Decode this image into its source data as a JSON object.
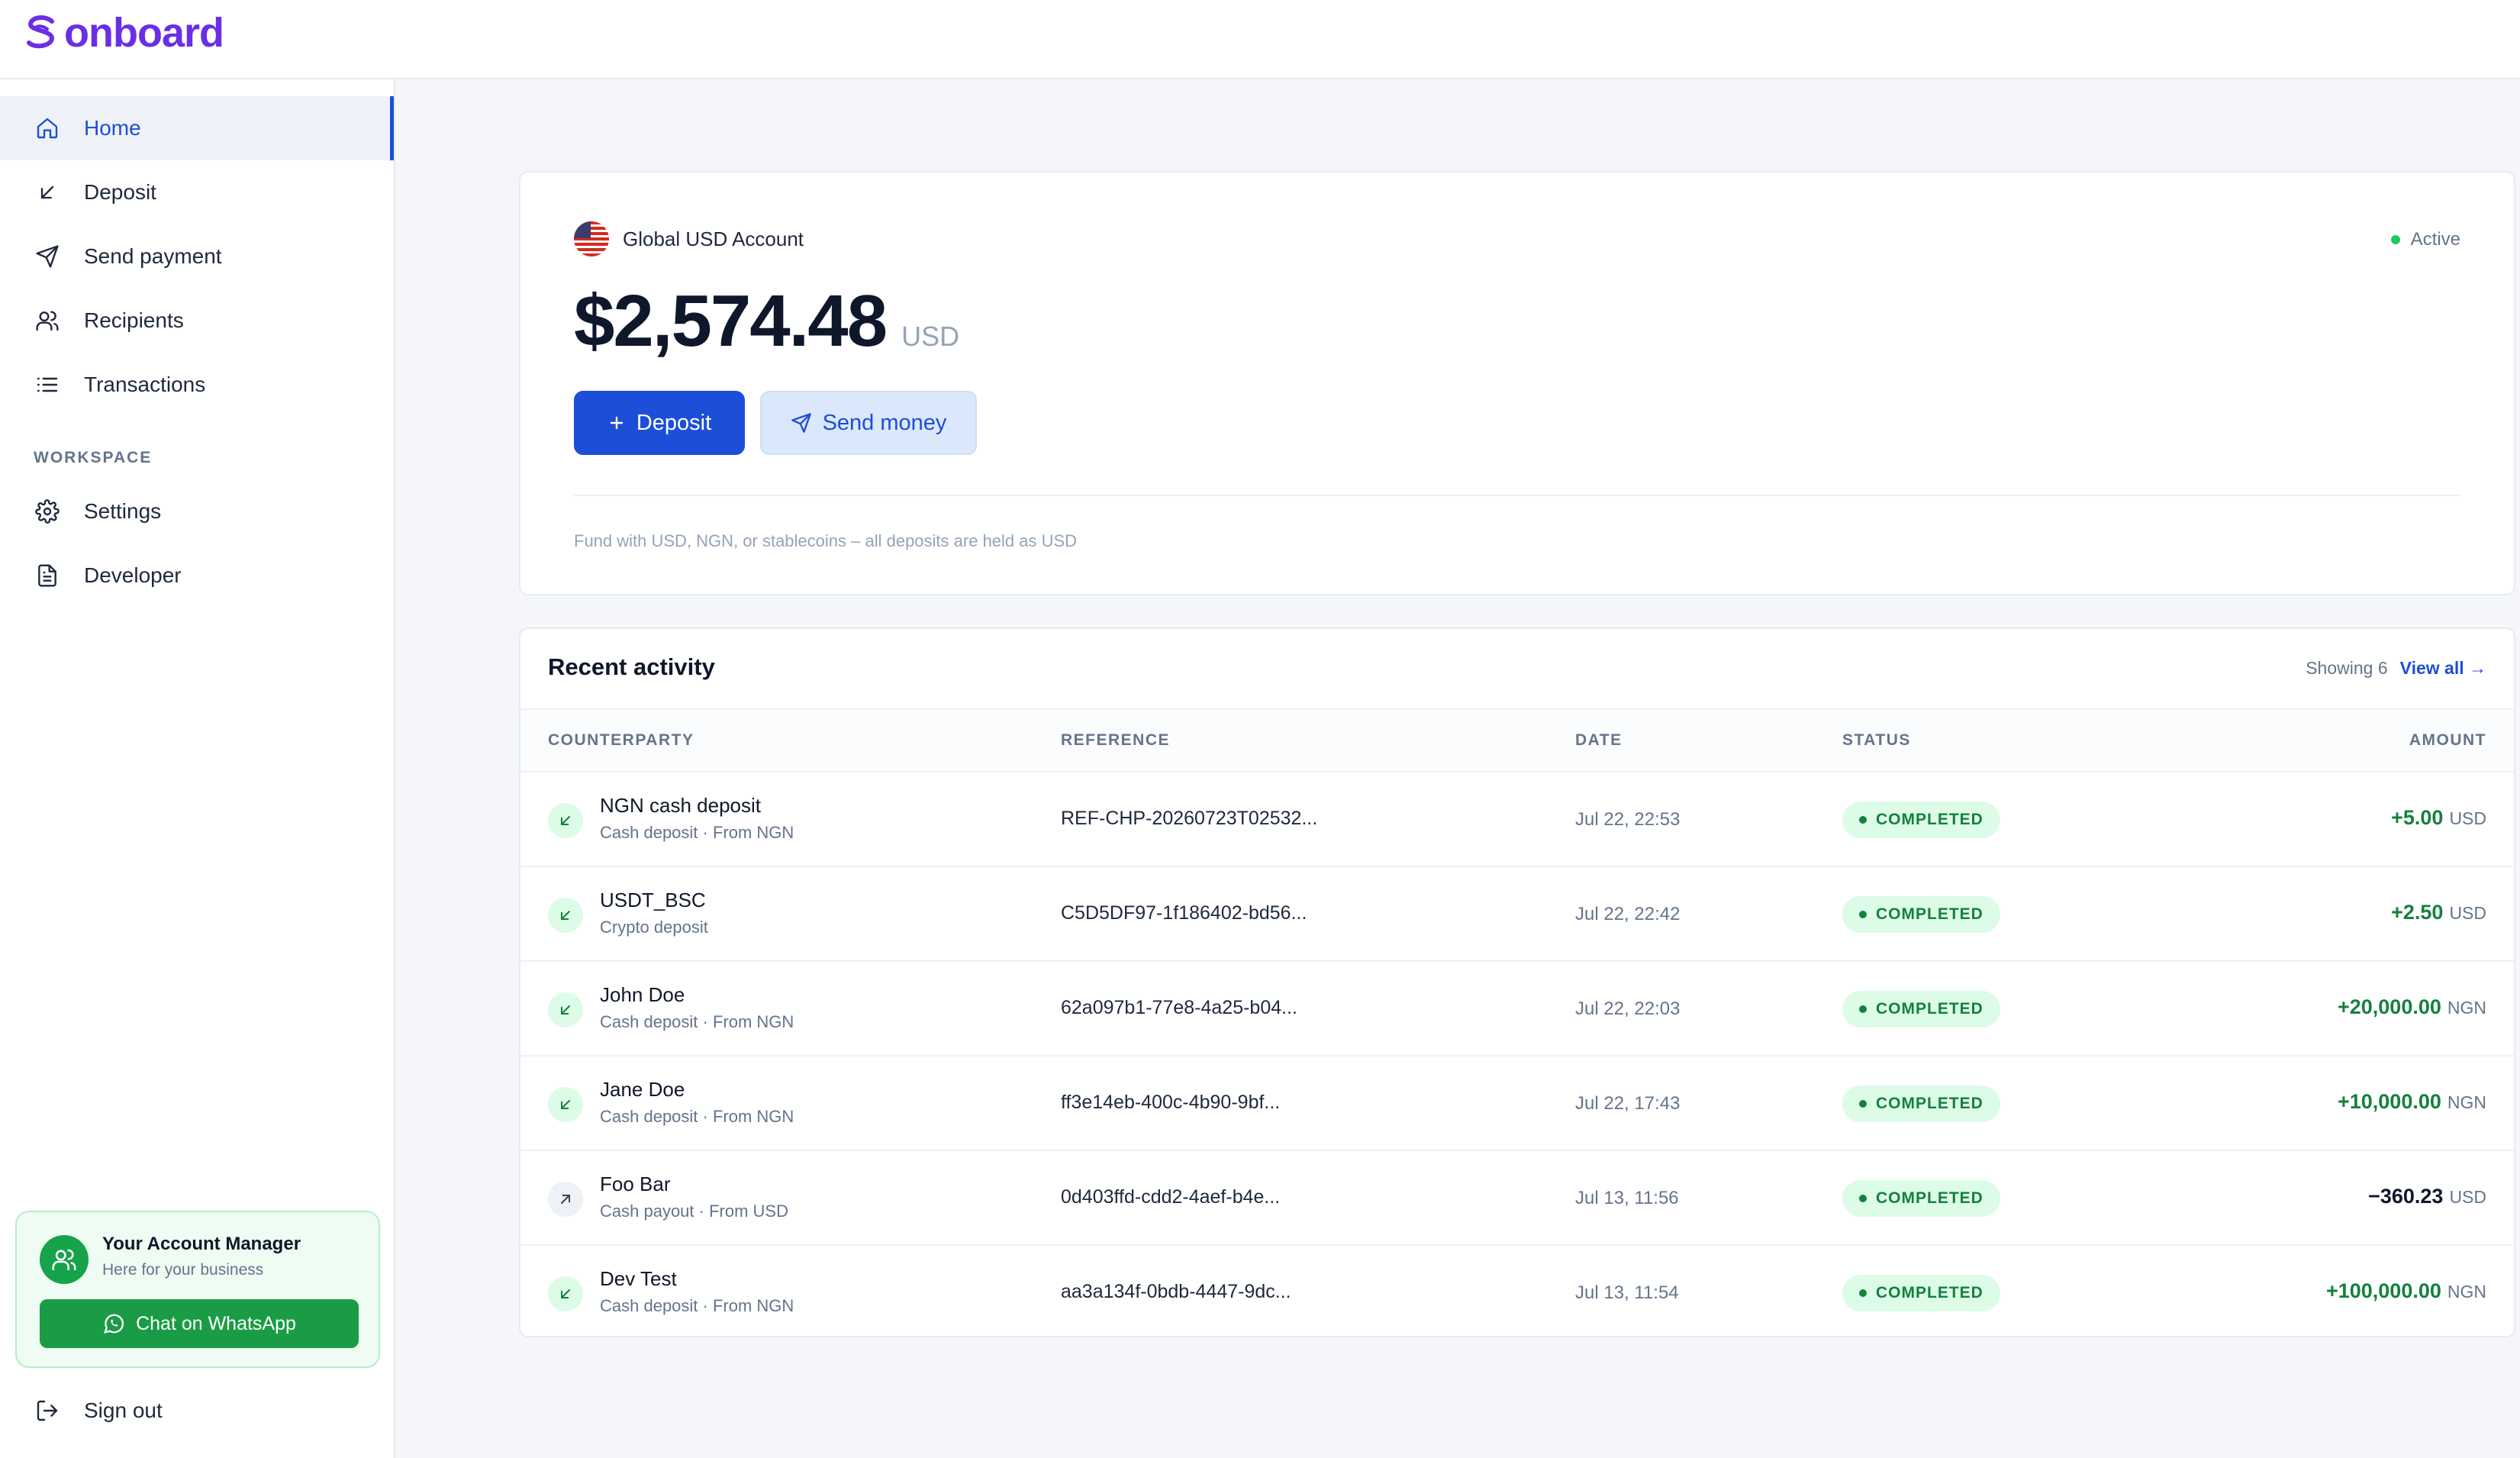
{
  "app": {
    "name": "onboard",
    "brand_color": "#6a2ee8",
    "accent_color": "#1d4ed8",
    "success_color": "#15803d"
  },
  "sidebar": {
    "items": [
      {
        "label": "Home",
        "icon": "home-icon",
        "active": true
      },
      {
        "label": "Deposit",
        "icon": "arrow-down-left-icon"
      },
      {
        "label": "Send payment",
        "icon": "send-icon"
      },
      {
        "label": "Recipients",
        "icon": "users-icon"
      },
      {
        "label": "Transactions",
        "icon": "list-icon"
      }
    ],
    "workspace_label": "WORKSPACE",
    "workspace_items": [
      {
        "label": "Settings",
        "icon": "gear-icon"
      },
      {
        "label": "Developer",
        "icon": "document-icon"
      }
    ],
    "manager": {
      "title": "Your Account Manager",
      "subtitle": "Here for your business",
      "button_label": "Chat on WhatsApp"
    },
    "sign_out_label": "Sign out"
  },
  "account": {
    "name": "Global USD Account",
    "status": "Active",
    "balance": "$2,574.48",
    "currency": "USD",
    "deposit_label": "Deposit",
    "send_label": "Send money",
    "note": "Fund with USD, NGN, or stablecoins – all deposits are held as USD"
  },
  "activity": {
    "title": "Recent activity",
    "showing": "Showing 6",
    "view_all": "View all →",
    "columns": {
      "counterparty": "COUNTERPARTY",
      "reference": "REFERENCE",
      "date": "DATE",
      "status": "STATUS",
      "amount": "AMOUNT"
    },
    "rows": [
      {
        "name": "NGN cash deposit",
        "sub": "Cash deposit · From NGN",
        "reference": "REF-CHP-20260723T02532...",
        "date": "Jul 22, 22:53",
        "status": "COMPLETED",
        "amount": "+5.00",
        "currency": "USD",
        "direction": "in"
      },
      {
        "name": "USDT_BSC",
        "sub": "Crypto deposit",
        "reference": "C5D5DF97-1f186402-bd56...",
        "date": "Jul 22, 22:42",
        "status": "COMPLETED",
        "amount": "+2.50",
        "currency": "USD",
        "direction": "in"
      },
      {
        "name": "John Doe",
        "sub": "Cash deposit · From NGN",
        "reference": "62a097b1-77e8-4a25-b04...",
        "date": "Jul 22, 22:03",
        "status": "COMPLETED",
        "amount": "+20,000.00",
        "currency": "NGN",
        "direction": "in"
      },
      {
        "name": "Jane Doe",
        "sub": "Cash deposit · From NGN",
        "reference": "ff3e14eb-400c-4b90-9bf...",
        "date": "Jul 22, 17:43",
        "status": "COMPLETED",
        "amount": "+10,000.00",
        "currency": "NGN",
        "direction": "in"
      },
      {
        "name": "Foo Bar",
        "sub": "Cash payout · From USD",
        "reference": "0d403ffd-cdd2-4aef-b4e...",
        "date": "Jul 13, 11:56",
        "status": "COMPLETED",
        "amount": "−360.23",
        "currency": "USD",
        "direction": "out"
      },
      {
        "name": "Dev Test",
        "sub": "Cash deposit · From NGN",
        "reference": "aa3a134f-0bdb-4447-9dc...",
        "date": "Jul 13, 11:54",
        "status": "COMPLETED",
        "amount": "+100,000.00",
        "currency": "NGN",
        "direction": "in"
      }
    ]
  }
}
